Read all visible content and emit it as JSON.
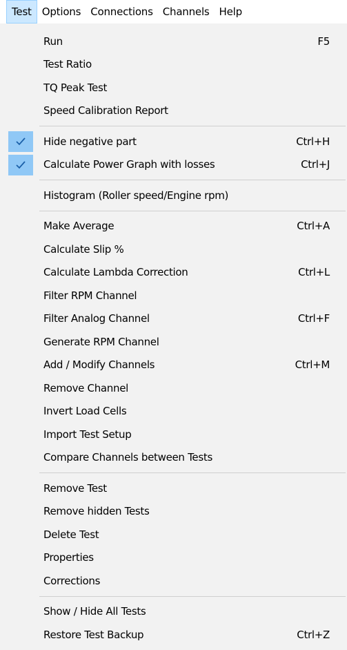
{
  "menubar": {
    "items": [
      {
        "label": "Test"
      },
      {
        "label": "Options"
      },
      {
        "label": "Connections"
      },
      {
        "label": "Channels"
      },
      {
        "label": "Help"
      }
    ]
  },
  "dropdown": {
    "items": [
      {
        "label": "Run",
        "shortcut": "F5",
        "checked": false
      },
      {
        "label": "Test Ratio",
        "shortcut": "",
        "checked": false
      },
      {
        "label": "TQ Peak Test",
        "shortcut": "",
        "checked": false
      },
      {
        "label": "Speed Calibration Report",
        "shortcut": "",
        "checked": false
      },
      {
        "label": "Hide negative part",
        "shortcut": "Ctrl+H",
        "checked": true
      },
      {
        "label": "Calculate Power Graph with losses",
        "shortcut": "Ctrl+J",
        "checked": true
      },
      {
        "label": "Histogram (Roller speed/Engine rpm)",
        "shortcut": "",
        "checked": false
      },
      {
        "label": "Make Average",
        "shortcut": "Ctrl+A",
        "checked": false
      },
      {
        "label": "Calculate Slip %",
        "shortcut": "",
        "checked": false
      },
      {
        "label": "Calculate Lambda Correction",
        "shortcut": "Ctrl+L",
        "checked": false
      },
      {
        "label": "Filter RPM Channel",
        "shortcut": "",
        "checked": false
      },
      {
        "label": "Filter Analog Channel",
        "shortcut": "Ctrl+F",
        "checked": false
      },
      {
        "label": "Generate RPM Channel",
        "shortcut": "",
        "checked": false
      },
      {
        "label": "Add / Modify Channels",
        "shortcut": "Ctrl+M",
        "checked": false
      },
      {
        "label": "Remove Channel",
        "shortcut": "",
        "checked": false
      },
      {
        "label": "Invert Load Cells",
        "shortcut": "",
        "checked": false
      },
      {
        "label": "Import Test Setup",
        "shortcut": "",
        "checked": false
      },
      {
        "label": "Compare Channels between Tests",
        "shortcut": "",
        "checked": false
      },
      {
        "label": "Remove Test",
        "shortcut": "",
        "checked": false
      },
      {
        "label": "Remove hidden Tests",
        "shortcut": "",
        "checked": false
      },
      {
        "label": "Delete Test",
        "shortcut": "",
        "checked": false
      },
      {
        "label": "Properties",
        "shortcut": "",
        "checked": false
      },
      {
        "label": "Corrections",
        "shortcut": "",
        "checked": false
      },
      {
        "label": "Show / Hide All Tests",
        "shortcut": "",
        "checked": false
      },
      {
        "label": "Restore Test Backup",
        "shortcut": "Ctrl+Z",
        "checked": false
      }
    ]
  },
  "colors": {
    "menubar_active_bg": "#cce8ff",
    "menubar_active_border": "#99d1ff",
    "dropdown_bg": "#f2f2f2",
    "check_bg": "#90c8f6",
    "check_mark": "#1a5fa8",
    "separator": "#cfcfcf"
  },
  "icons": {
    "check": "checkmark-icon"
  }
}
